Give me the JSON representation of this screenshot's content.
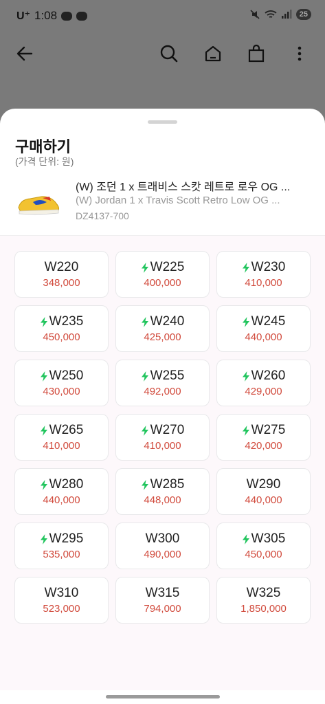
{
  "status_bar": {
    "carrier": "U⁺",
    "time": "1:08",
    "battery": "25"
  },
  "app_bar": {
    "back_icon": "back-arrow-icon",
    "search_icon": "search-icon",
    "home_icon": "home-icon",
    "bag_icon": "shopping-bag-icon",
    "more_icon": "more-vertical-icon"
  },
  "sheet": {
    "title": "구매하기",
    "unit_note": "(가격 단위: 원)"
  },
  "product": {
    "name_ko": "(W) 조던 1 x 트래비스 스캇 레트로 로우 OG ...",
    "name_en": "(W) Jordan 1 x Travis Scott Retro Low OG ...",
    "model_code": "DZ4137-700"
  },
  "colors": {
    "price": "#d14a3c",
    "bolt": "#22c55e",
    "grid_background": "#fdf8fb"
  },
  "sizes": [
    {
      "label": "W220",
      "price": "348,000",
      "fast": false
    },
    {
      "label": "W225",
      "price": "400,000",
      "fast": true
    },
    {
      "label": "W230",
      "price": "410,000",
      "fast": true
    },
    {
      "label": "W235",
      "price": "450,000",
      "fast": true
    },
    {
      "label": "W240",
      "price": "425,000",
      "fast": true
    },
    {
      "label": "W245",
      "price": "440,000",
      "fast": true
    },
    {
      "label": "W250",
      "price": "430,000",
      "fast": true
    },
    {
      "label": "W255",
      "price": "492,000",
      "fast": true
    },
    {
      "label": "W260",
      "price": "429,000",
      "fast": true
    },
    {
      "label": "W265",
      "price": "410,000",
      "fast": true
    },
    {
      "label": "W270",
      "price": "410,000",
      "fast": true
    },
    {
      "label": "W275",
      "price": "420,000",
      "fast": true
    },
    {
      "label": "W280",
      "price": "440,000",
      "fast": true
    },
    {
      "label": "W285",
      "price": "448,000",
      "fast": true
    },
    {
      "label": "W290",
      "price": "440,000",
      "fast": false
    },
    {
      "label": "W295",
      "price": "535,000",
      "fast": true
    },
    {
      "label": "W300",
      "price": "490,000",
      "fast": false
    },
    {
      "label": "W305",
      "price": "450,000",
      "fast": true
    },
    {
      "label": "W310",
      "price": "523,000",
      "fast": false
    },
    {
      "label": "W315",
      "price": "794,000",
      "fast": false
    },
    {
      "label": "W325",
      "price": "1,850,000",
      "fast": false
    }
  ]
}
